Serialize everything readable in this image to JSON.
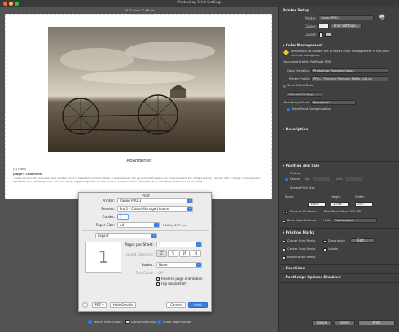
{
  "window": {
    "title": "Photoshop Print Settings"
  },
  "preview": {
    "size_label": "28.67 cm x 22.86 cm",
    "title": "Abandoned",
    "caption_line1": "(C) roads",
    "comments_heading": "Judge's Comments",
    "comments_text": "I really like this. The toned sea well handled and it is beautifully printed. Details it is abandoned, the agricultural thingie in the foreground and the cottage behind. I wonder if the cottage could be better separated from the background. The print has an ragged edge, which I fine, and I'm complements to the subject as to the feeling. Distinction for checking."
  },
  "bottom": {
    "match_print_colors": "Match Print Colors",
    "gamut_warning": "Gamut Warning",
    "show_paper_white": "Show Paper White"
  },
  "print_dialog": {
    "heading": "Print",
    "printer_label": "Printer:",
    "printer_value": "Canon PRO-1",
    "presets_label": "Presets:",
    "presets_value": "Pro 1 - Colour Managed Lustre",
    "copies_label": "Copies:",
    "copies_value": "1",
    "paper_size_label": "Paper Size:",
    "paper_size_value": "A4",
    "paper_size_dims": "210 by 297 mm",
    "section_value": "Layout",
    "page_number_preview": "1",
    "pages_per_sheet_label": "Pages per Sheet:",
    "pages_per_sheet_value": "1",
    "layout_direction_label": "Layout Direction:",
    "border_label": "Border:",
    "border_value": "None",
    "two_sided_label": "Two-Sided:",
    "two_sided_value": "Off",
    "reverse_orientation": "Reverse page orientation",
    "flip_horizontally": "Flip horizontally",
    "help_label": "?",
    "pdf_label": "PDF",
    "hide_details_label": "Hide Details",
    "cancel_label": "Cancel",
    "print_label": "Print"
  },
  "panel": {
    "printer_setup": {
      "heading": "Printer Setup",
      "printer_label": "Printer:",
      "printer_value": "Canon PRO-1",
      "copies_label": "Copies:",
      "copies_value": "1",
      "print_settings_label": "Print Settings...",
      "layout_label": "Layout:"
    },
    "color_management": {
      "heading": "Color Management",
      "reminder": "Remember to disable the printer's color management in the print settings dialog box.",
      "document_profile": "Document Profile: ProPhoto RGB",
      "color_handling_label": "Color Handling:",
      "color_handling_value": "Photoshop Manages Colors",
      "printer_profile_label": "Printer Profile:",
      "printer_profile_value": "PRO-1 Pinnacle Premium Matte (v4).icc",
      "send_16bit": "Send 16-bit Data",
      "normal_printing": "Normal Printing",
      "rendering_intent_label": "Rendering Intent:",
      "rendering_intent_value": "Perceptual",
      "black_point": "Black Point Compensation"
    },
    "description": {
      "heading": "Description"
    },
    "position_size": {
      "heading": "Position and Size",
      "position_label": "Position",
      "center_label": "Center",
      "top_label": "Top:",
      "left_label": "Left:",
      "scaled_print_size": "Scaled Print Size",
      "scale_label": "Scale:",
      "height_label": "Height:",
      "width_label": "Width:",
      "scale_value": "100%",
      "height_value": "20.98",
      "width_value": "29.7",
      "scale_to_fit": "Scale to Fit Media",
      "print_resolution": "Print Resolution: 300 PPI",
      "print_selected_area": "Print Selected Area",
      "units_label": "Units:",
      "units_value": "Centimeters"
    },
    "printing_marks": {
      "heading": "Printing Marks",
      "corner_crop_marks": "Corner Crop Marks",
      "description_label": "Description",
      "edit_label": "Edit...",
      "center_crop_marks": "Center Crop Marks",
      "labels_label": "Labels",
      "registration_marks": "Registration Marks"
    },
    "functions": {
      "heading": "Functions"
    },
    "postscript": {
      "heading": "PostScript Options Disabled"
    },
    "buttons": {
      "cancel": "Cancel",
      "done": "Done",
      "print": "Print"
    }
  },
  "colors": {
    "accent": "#3c7fe2",
    "panel_bg": "#404040",
    "dialog_bg": "#ececec"
  },
  "icons": {
    "printer": "printer-icon",
    "portrait": "portrait-orientation-icon",
    "landscape": "landscape-orientation-icon"
  }
}
